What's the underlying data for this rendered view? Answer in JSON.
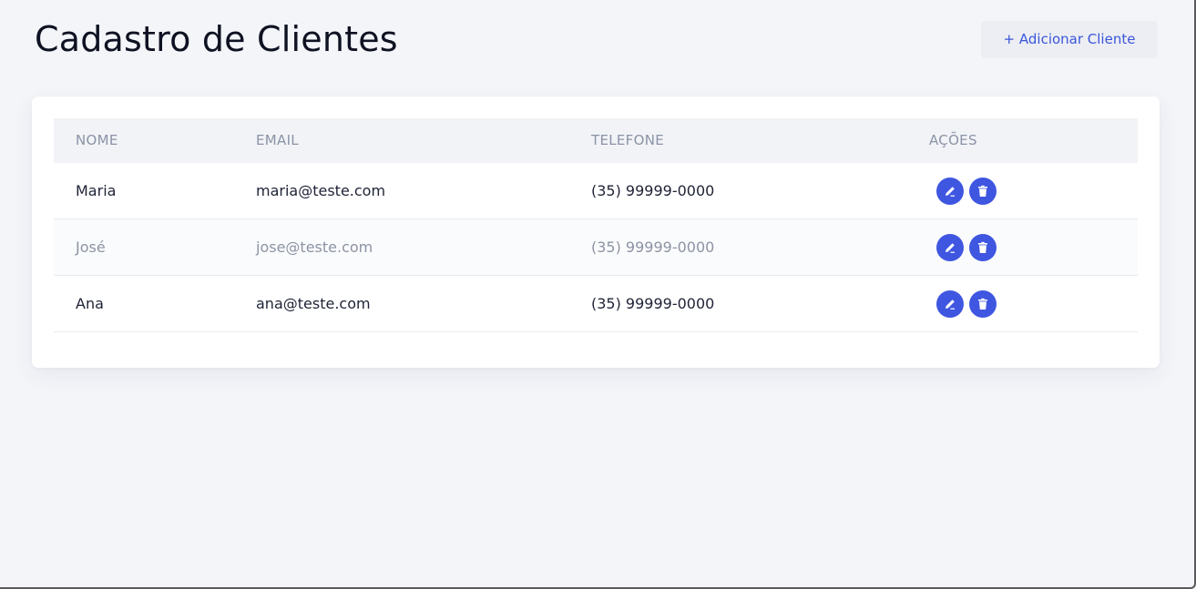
{
  "header": {
    "title": "Cadastro de Clientes",
    "add_button_label": "+ Adicionar Cliente"
  },
  "table": {
    "columns": [
      "NOME",
      "EMAIL",
      "TELEFONE",
      "AÇÕES"
    ],
    "rows": [
      {
        "nome": "Maria",
        "email": "maria@teste.com",
        "telefone": "(35) 99999-0000"
      },
      {
        "nome": "José",
        "email": "jose@teste.com",
        "telefone": "(35) 99999-0000"
      },
      {
        "nome": "Ana",
        "email": "ana@teste.com",
        "telefone": "(35) 99999-0000"
      }
    ],
    "row_actions": {
      "edit_icon": "pencil-icon",
      "delete_icon": "trash-icon"
    }
  },
  "colors": {
    "accent": "#3f56e0",
    "background": "#f4f5f9",
    "title": "#0f1222",
    "header_text": "#8b93a6"
  }
}
